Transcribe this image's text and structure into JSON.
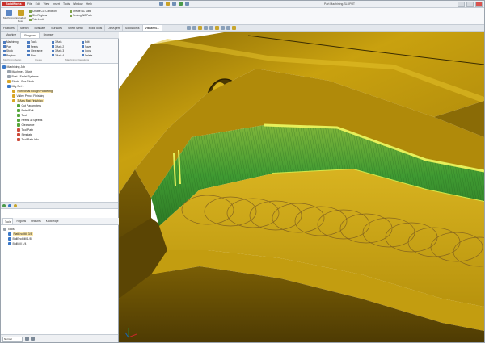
{
  "app": {
    "brand": "SolidWorks",
    "doc_title": "Part Machining.SLDPRT"
  },
  "menu": [
    "File",
    "Edit",
    "View",
    "Insert",
    "Tools",
    "Window",
    "Help"
  ],
  "ribbon": {
    "buttons": [
      {
        "icon": "machining-icon",
        "label": "Machining"
      },
      {
        "icon": "extrude-icon",
        "label": "Extruded Boss"
      }
    ],
    "group1": [
      "Create Cut Condition",
      "Sim Regions",
      "Trim Limit"
    ],
    "group2": [
      "Create NC Data",
      "Nesting NC Path"
    ]
  },
  "command_tabs": [
    "Features",
    "Sketch",
    "Evaluate",
    "Surfaces",
    "Sheet Metal",
    "Mold Tools",
    "DimXpert",
    "SolidWorks",
    "VisualMILL"
  ],
  "active_command_tab": "VisualMILL",
  "left_tabs": [
    "Machine",
    "Program",
    "Browser"
  ],
  "left_ribbon": {
    "col1": [
      "Machining",
      "Part",
      "Stock",
      "Regions"
    ],
    "col2": [
      "Tools",
      "Feeds",
      "Clearance",
      "Rim"
    ],
    "col3": [
      "3 Axis",
      "3 Axis 2",
      "3 Axis 3",
      "3 Axis 4"
    ],
    "col4": [
      "Edit",
      "Save",
      "Copy",
      "Delete"
    ],
    "group_labels": [
      "Machining Setup",
      "Create",
      "Machining Operations"
    ]
  },
  "tree": [
    {
      "level": 0,
      "label": "Machining Job",
      "bullet": "blue"
    },
    {
      "level": 1,
      "label": "Machine - 3 Axis",
      "bullet": "gray"
    },
    {
      "level": 1,
      "label": "Post - Fadal Systems",
      "bullet": "gray"
    },
    {
      "level": 1,
      "label": "Stock - Box Stock",
      "bullet": "gold"
    },
    {
      "level": 1,
      "label": "Mfg Set 1",
      "bullet": "blue"
    },
    {
      "level": 2,
      "label": "Horizontal Rough Pocketing",
      "bullet": "gold",
      "selected": true
    },
    {
      "level": 2,
      "label": "Valley Pencil Finishing",
      "bullet": "gold"
    },
    {
      "level": 2,
      "label": "3 Axis Flat Finishing",
      "bullet": "gold",
      "selected": true
    },
    {
      "level": 3,
      "label": "Cut Parameters",
      "bullet": "green"
    },
    {
      "level": 3,
      "label": "Entry/Exit",
      "bullet": "green"
    },
    {
      "level": 3,
      "label": "Tool",
      "bullet": "green"
    },
    {
      "level": 3,
      "label": "Feeds & Speeds",
      "bullet": "green"
    },
    {
      "level": 3,
      "label": "Clearance",
      "bullet": "green"
    },
    {
      "level": 3,
      "label": "Tool Path",
      "bullet": "red"
    },
    {
      "level": 3,
      "label": "Simulate",
      "bullet": "red"
    },
    {
      "level": 3,
      "label": "Tool Path Info",
      "bullet": "red"
    }
  ],
  "lower_tabs": [
    "Tools",
    "Regions",
    "Features",
    "Knowledge"
  ],
  "tree2": [
    {
      "level": 0,
      "label": "Tools",
      "bullet": "gray"
    },
    {
      "level": 1,
      "label": "FlatEndMill 3/8",
      "bullet": "blue",
      "selected": true
    },
    {
      "level": 1,
      "label": "BallEndMill 1/8",
      "bullet": "blue"
    },
    {
      "level": 1,
      "label": "BullMill 1/4",
      "bullet": "blue"
    }
  ],
  "status": {
    "field_text": "Normal"
  },
  "colors": {
    "part_gold": "#c9a10f",
    "part_shadow": "#6e5406",
    "toolpath_green": "#3f9a32",
    "accent_highlight": "#e6f05a"
  }
}
